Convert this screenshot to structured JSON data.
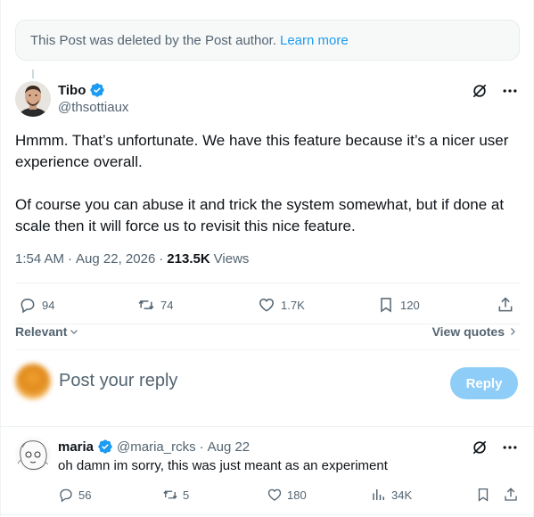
{
  "deleted_notice": {
    "text": "This Post was deleted by the Post author.",
    "link": "Learn more"
  },
  "post": {
    "author_name": "Tibo",
    "author_handle": "@thsottiaux",
    "paragraph1": "Hmmm. That’s unfortunate. We have this feature because it’s a nicer user experience overall.",
    "paragraph2": "Of course you can abuse it and trick the system somewhat, but if done at scale then it will force us to revisit this nice feature.",
    "time": "1:54 AM",
    "date": "Aug 22, 2026",
    "views_count": "213.5K",
    "views_label": "Views",
    "replies": "94",
    "reposts": "74",
    "likes": "1.7K",
    "bookmarks": "120"
  },
  "sort": {
    "label": "Relevant",
    "view_quotes": "View quotes"
  },
  "composer": {
    "placeholder": "Post your reply",
    "button": "Reply"
  },
  "reply": {
    "name": "maria",
    "handle": "@maria_rcks",
    "date": "Aug 22",
    "text": "oh damn im sorry, this was just meant as an experiment",
    "replies": "56",
    "reposts": "5",
    "likes": "180",
    "views": "34K"
  },
  "colors": {
    "accent": "#1d9bf0",
    "muted": "#536471",
    "reply_button": "#8ecdf7"
  }
}
